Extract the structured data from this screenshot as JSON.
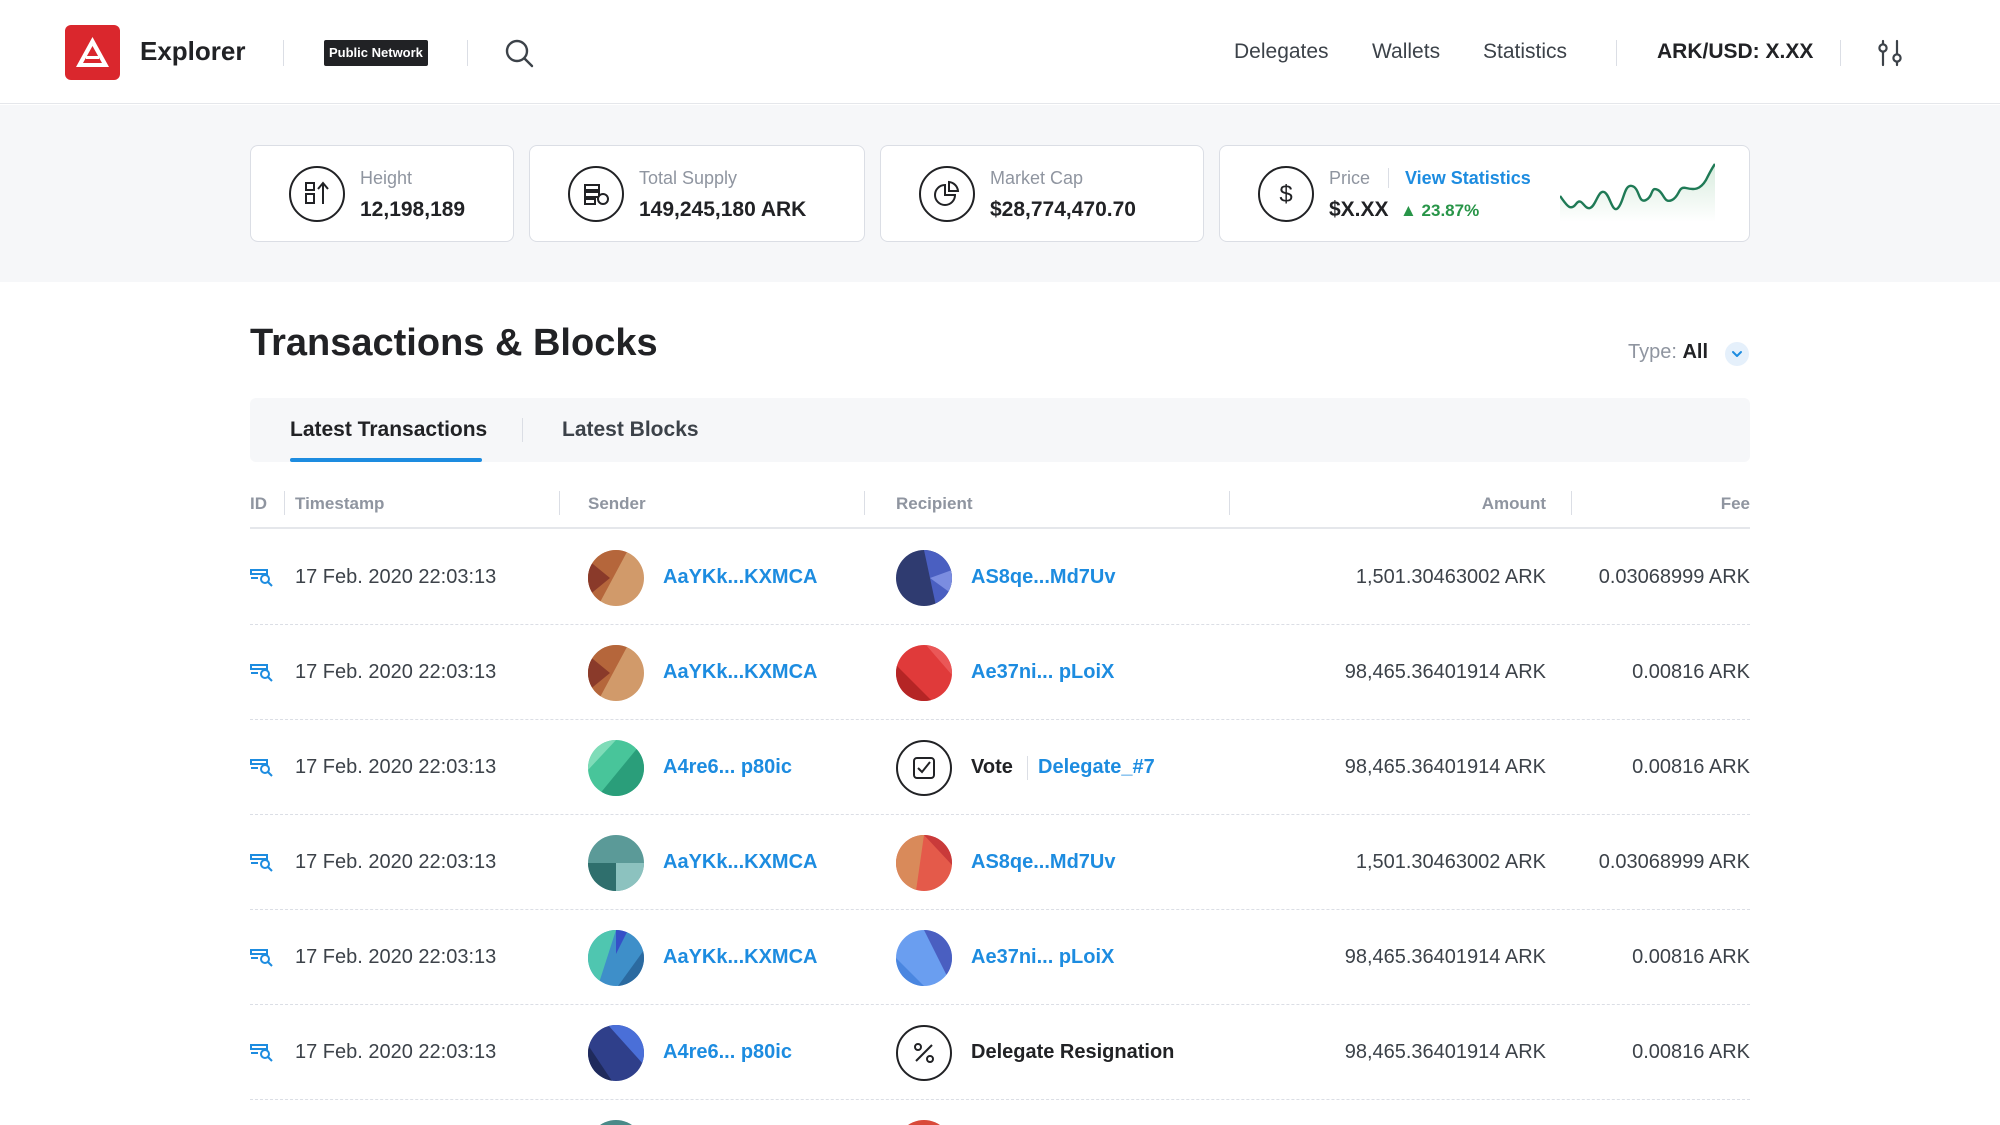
{
  "header": {
    "brand": "Explorer",
    "network_badge": "Public Network",
    "nav": [
      "Delegates",
      "Wallets",
      "Statistics"
    ],
    "price_ticker": "ARK/USD: X.XX",
    "accent": "#da272d"
  },
  "stats": {
    "height": {
      "label": "Height",
      "value": "12,198,189"
    },
    "supply": {
      "label": "Total Supply",
      "value": "149,245,180 ARK"
    },
    "market_cap": {
      "label": "Market Cap",
      "value": "$28,774,470.70"
    },
    "price": {
      "label": "Price",
      "link": "View Statistics",
      "value": "$X.XX",
      "change": "▲ 23.87%"
    }
  },
  "main": {
    "title": "Transactions & Blocks",
    "type_label": "Type: ",
    "type_value": "All",
    "tabs": [
      "Latest Transactions",
      "Latest Blocks"
    ],
    "columns": [
      "ID",
      "Timestamp",
      "Sender",
      "Recipient",
      "Amount",
      "Fee"
    ]
  },
  "transactions": [
    {
      "timestamp": "17 Feb. 2020 22:03:13",
      "sender": "AaYKk...KXMCA",
      "recipient": "AS8qe...Md7Uv",
      "amount": "1,501.30463002 ARK",
      "fee": "0.03068999 ARK"
    },
    {
      "timestamp": "17 Feb. 2020 22:03:13",
      "sender": "AaYKk...KXMCA",
      "recipient": "Ae37ni... pLoiX",
      "amount": "98,465.36401914 ARK",
      "fee": "0.00816 ARK"
    },
    {
      "timestamp": "17 Feb. 2020 22:03:13",
      "sender": "A4re6... p80ic",
      "recipient_label": "Vote",
      "recipient": "Delegate_#7",
      "amount": "98,465.36401914 ARK",
      "fee": "0.00816 ARK"
    },
    {
      "timestamp": "17 Feb. 2020 22:03:13",
      "sender": "AaYKk...KXMCA",
      "recipient": "AS8qe...Md7Uv",
      "amount": "1,501.30463002 ARK",
      "fee": "0.03068999 ARK"
    },
    {
      "timestamp": "17 Feb. 2020 22:03:13",
      "sender": "AaYKk...KXMCA",
      "recipient": "Ae37ni... pLoiX",
      "amount": "98,465.36401914 ARK",
      "fee": "0.00816 ARK"
    },
    {
      "timestamp": "17 Feb. 2020 22:03:13",
      "sender": "A4re6... p80ic",
      "recipient_label": "Delegate Resignation",
      "amount": "98,465.36401914 ARK",
      "fee": "0.00816 ARK"
    }
  ]
}
